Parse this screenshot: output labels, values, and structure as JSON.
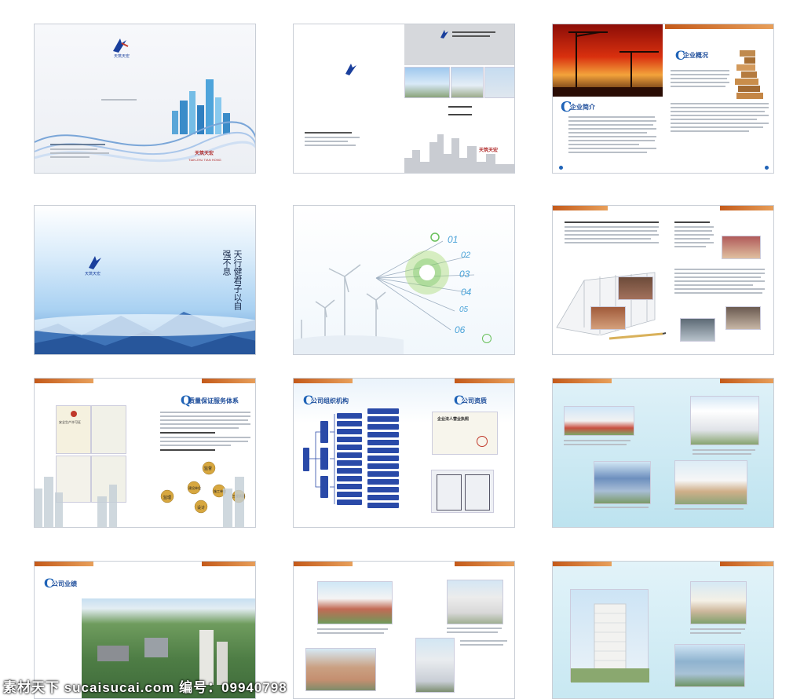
{
  "brand": {
    "logo_text": "天筑天宏",
    "logo_pinyin": "TIAN ZHU TIAN HONG"
  },
  "sections": {
    "company_profile": "企业简介",
    "company_overview": "企业概况",
    "quality_system": "质量保证服务体系",
    "org_structure": "公司组织机构",
    "qualifications": "公司资质",
    "performance": "公司业绩"
  },
  "timeline": [
    "01",
    "02",
    "03",
    "04",
    "05",
    "06"
  ],
  "certificate": {
    "safety_license": "安全生产许可证",
    "business_license": "企业法人营业执照"
  },
  "quality_circle": {
    "top": "监督",
    "left": "监理",
    "right": "工程质量",
    "center_left": "建设单位",
    "center_right": "施工单位",
    "bottom": "设计"
  },
  "vertical_poem": [
    "天",
    "行",
    "健",
    "君",
    "子",
    "以",
    "自",
    "强",
    "不",
    "息"
  ],
  "watermark": "素材天下 sucaisucai.com  编号：09940798"
}
